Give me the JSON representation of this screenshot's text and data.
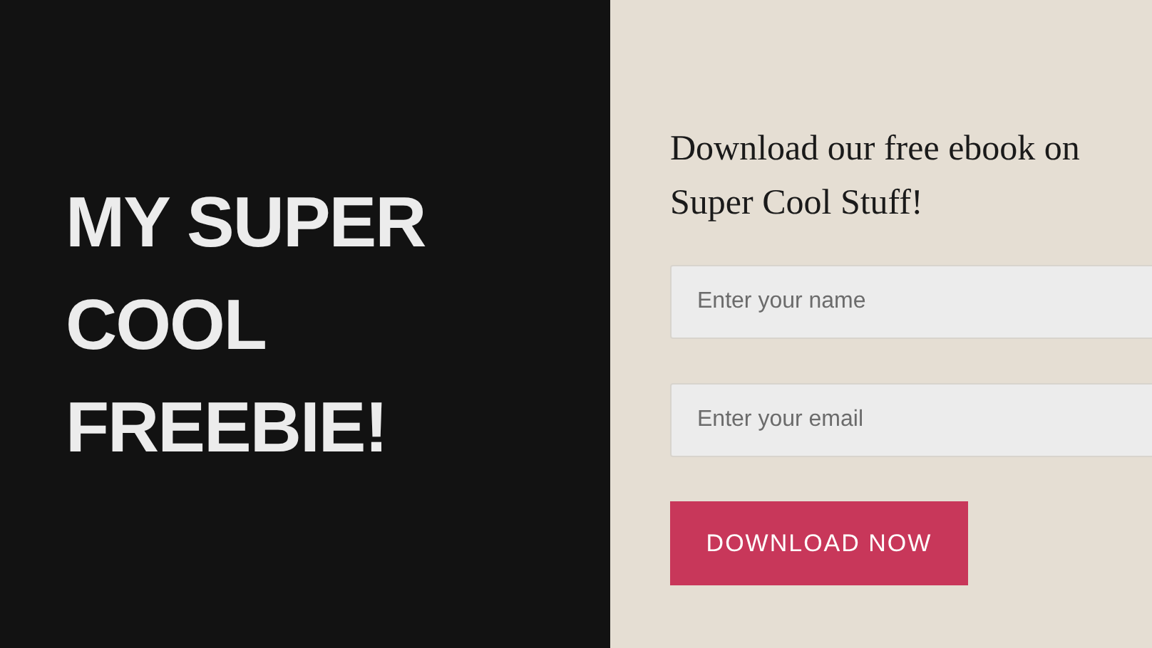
{
  "hero": {
    "title": "MY SUPER COOL FREEBIE!"
  },
  "form": {
    "heading": "Download our free ebook on Super Cool Stuff!",
    "fields": [
      {
        "placeholder": "Enter your name"
      },
      {
        "placeholder": "Enter your email"
      }
    ],
    "button": "DOWNLOAD NOW"
  }
}
